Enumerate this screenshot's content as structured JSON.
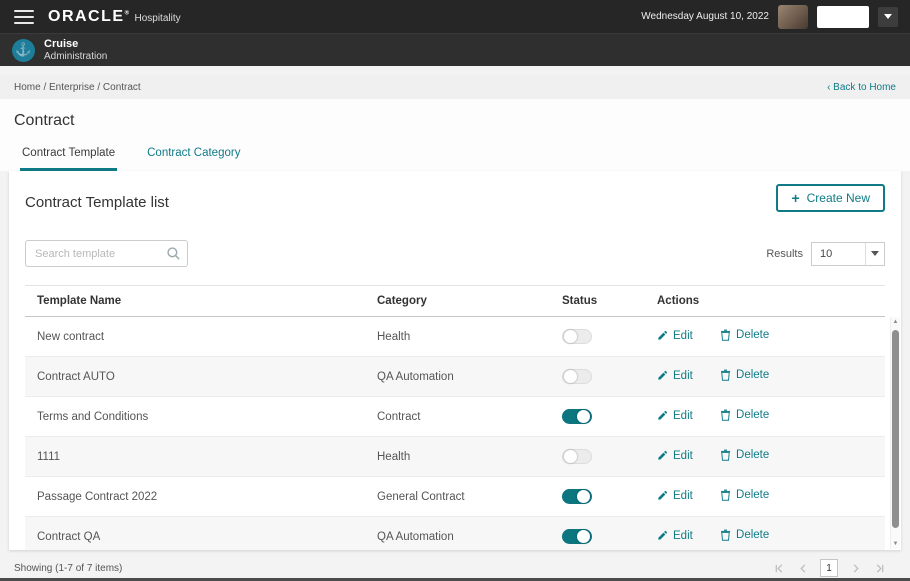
{
  "colors": {
    "accent": "#0f7b87",
    "toggle_on": "#0c7680",
    "header_bg": "#262626"
  },
  "topbar": {
    "brand": "ORACLE",
    "brand_mark": "®",
    "brand_suffix": "Hospitality",
    "date": "Wednesday August 10, 2022"
  },
  "appbar": {
    "app_name": "Cruise",
    "app_subtitle": "Administration",
    "logo_glyph": "⚓"
  },
  "breadcrumb": {
    "path": "Home / Enterprise / Contract",
    "back_link": "‹ Back to Home"
  },
  "page": {
    "title": "Contract",
    "tabs": [
      {
        "label": "Contract Template",
        "active": true
      },
      {
        "label": "Contract Category",
        "active": false
      }
    ]
  },
  "card": {
    "heading": "Contract Template list",
    "create_plus": "+",
    "create_button": "Create New",
    "search_placeholder": "Search template",
    "results_label": "Results",
    "results_value": "10"
  },
  "table": {
    "columns": [
      "Template Name",
      "Category",
      "Status",
      "Actions"
    ],
    "edit_label": "Edit",
    "delete_label": "Delete",
    "rows": [
      {
        "name": "New contract",
        "category": "Health",
        "status_on": false
      },
      {
        "name": "Contract AUTO",
        "category": "QA Automation",
        "status_on": false
      },
      {
        "name": "Terms and Conditions",
        "category": "Contract",
        "status_on": true
      },
      {
        "name": "1111",
        "category": "Health",
        "status_on": false
      },
      {
        "name": "Passage Contract 2022",
        "category": "General Contract",
        "status_on": true
      },
      {
        "name": "Contract QA",
        "category": "QA Automation",
        "status_on": true
      }
    ]
  },
  "footer": {
    "showing": "Showing (1-7 of 7 items)",
    "page": "1"
  }
}
